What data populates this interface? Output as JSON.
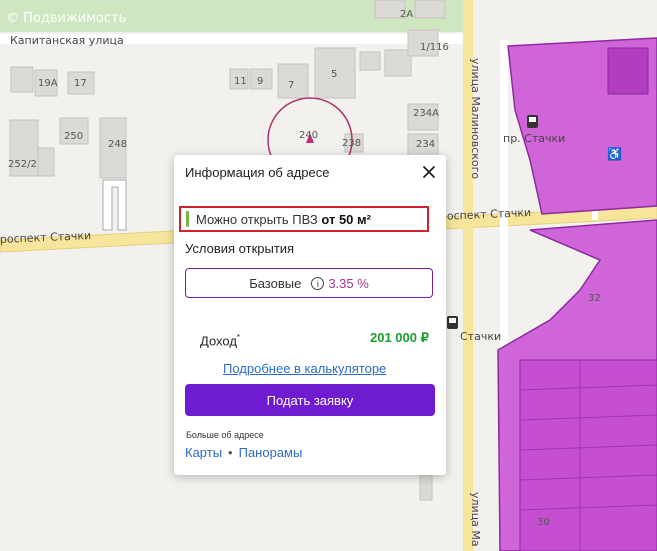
{
  "map": {
    "watermark": "© Подвижимость",
    "streets": {
      "kapitanskaya": "Капитанская улица",
      "stachki_left": "роспект Стачки",
      "stachki_right": "роспект Стачки",
      "malinovskogo_top": "улица Малиновского",
      "malinovskogo_bottom": "улица Ма",
      "pr_stachki": "пр. Стачки",
      "stachki_stop": "Стачки"
    },
    "house_numbers": [
      "19А",
      "17",
      "11",
      "9",
      "7",
      "5",
      "250",
      "248",
      "240",
      "238",
      "234А",
      "234",
      "252/2",
      "1/116",
      "2А",
      "30",
      "32"
    ],
    "colors": {
      "zone_fill": "#cc55d6",
      "zone_stroke": "#8e2aa0",
      "road": "#f7e59c",
      "park": "#cfe7c0",
      "building": "#dcdad6"
    }
  },
  "popup": {
    "title": "Информация об адресе",
    "notice_text": "Можно открыть ПВЗ",
    "notice_bold": "от 50 м²",
    "conditions_title": "Условия открытия",
    "base_label": "Базовые",
    "info_icon": "i",
    "base_percent": "3.35 %",
    "income_label": "Доход",
    "income_asterisk": "*",
    "income_value": "201 000 ₽",
    "calculator_link": "Подробнее в калькуляторе",
    "submit_button": "Подать заявку",
    "more_label": "Больше об адресе",
    "link_maps": "Карты",
    "separator": "•",
    "link_panoramas": "Панорамы"
  }
}
